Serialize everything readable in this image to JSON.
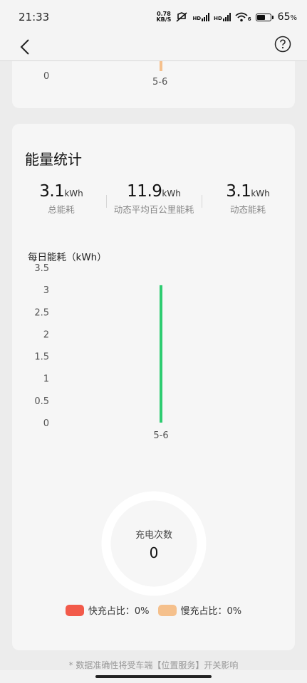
{
  "status_bar": {
    "time": "21:33",
    "net_speed_value": "0.78",
    "net_speed_unit": "KB/S",
    "hd1": "HD",
    "hd2": "HD",
    "wifi_badge": "6",
    "battery_percent": "65",
    "battery_symbol": "%",
    "battery_level": 0.65
  },
  "header": {
    "back_icon": "chevron-left-icon",
    "help_icon": "question-circle-icon"
  },
  "previous_card": {
    "zero_label": "0",
    "date_label": "5-6",
    "bar_color": "#f5c08c"
  },
  "energy": {
    "title": "能量统计",
    "stats": [
      {
        "value": "3.1",
        "unit": "kWh",
        "label": "总能耗"
      },
      {
        "value": "11.9",
        "unit": "kWh",
        "label": "动态平均百公里能耗"
      },
      {
        "value": "3.1",
        "unit": "kWh",
        "label": "动态能耗"
      }
    ],
    "chart_title": "每日能耗（kWh）"
  },
  "chart_data": {
    "type": "bar",
    "title": "每日能耗（kWh）",
    "categories": [
      "5-6"
    ],
    "values": [
      3.1
    ],
    "ylim": [
      0,
      3.5
    ],
    "yticks": [
      "3.5",
      "3",
      "2.5",
      "2",
      "1.5",
      "1",
      "0.5",
      "0"
    ],
    "bar_color": "#2ecc71",
    "grid": false
  },
  "charging": {
    "ring_label": "充电次数",
    "count": "0",
    "legend": [
      {
        "label": "快充占比：0%",
        "color": "#f25a4a"
      },
      {
        "label": "慢充占比：0%",
        "color": "#f5c08c"
      }
    ]
  },
  "footer": {
    "note": "* 数据准确性将受车端【位置服务】开关影响"
  }
}
